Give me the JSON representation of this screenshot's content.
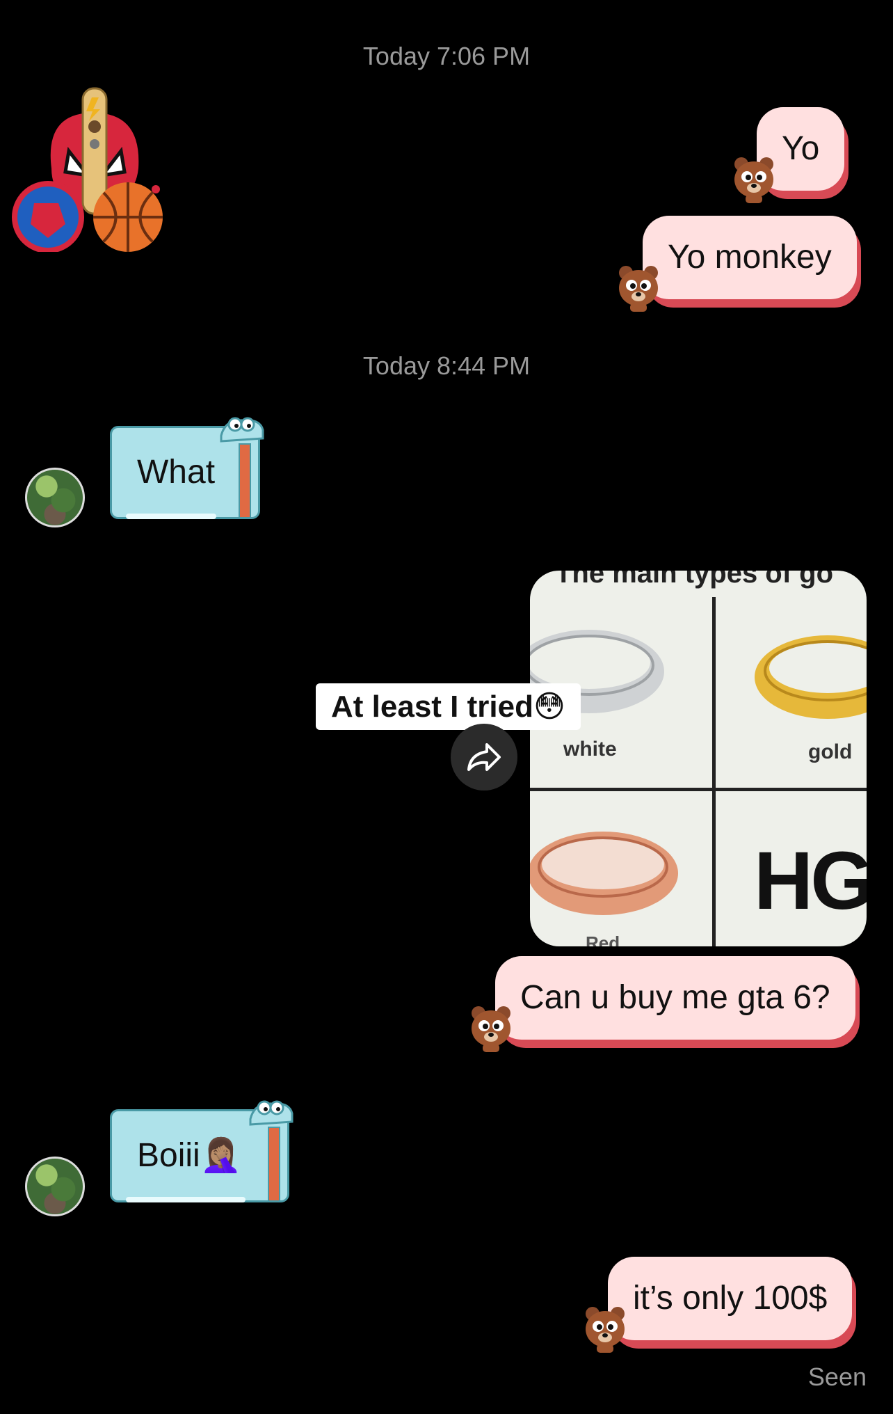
{
  "timestamps": [
    "Today 7:06 PM",
    "Today 8:44 PM"
  ],
  "messages": {
    "sent_1": "Yo",
    "sent_2": "Yo monkey",
    "recv_1": "What",
    "sent_3": "Can u buy me gta 6?",
    "recv_2": "Boiii🤦🏽‍♀️",
    "sent_4": "it’s only 100$"
  },
  "shared_post": {
    "header_text": "The main types of go",
    "labels": [
      "white",
      "gold",
      "Red",
      "HG"
    ],
    "caption": "At least I tried😳"
  },
  "status": "Seen",
  "icons": [
    "sticker-icon",
    "bear-icon",
    "dino-bubble-icon",
    "share-arrow-icon",
    "avatar"
  ],
  "colors": {
    "background": "#000000",
    "sent_bubble": "#ffe0e0",
    "sent_shadow": "#d84a55",
    "recv_bubble": "#aee2ea",
    "timestamp": "#9a9a9a"
  }
}
